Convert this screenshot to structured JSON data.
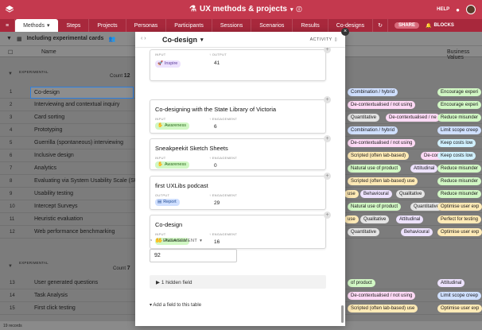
{
  "header": {
    "title": "UX methods & projects",
    "help": "HELP"
  },
  "tabs": [
    {
      "label": "Methods"
    },
    {
      "label": "Steps"
    },
    {
      "label": "Projects"
    },
    {
      "label": "Personas"
    },
    {
      "label": "Participants"
    },
    {
      "label": "Sessions"
    },
    {
      "label": "Scenarios"
    },
    {
      "label": "Results"
    },
    {
      "label": "Co-designs"
    }
  ],
  "share_label": "SHARE",
  "blocks_label": "BLOCKS",
  "view": {
    "name": "Including experimental cards"
  },
  "grid": {
    "name_header": "Name",
    "right_header": "Business Values",
    "section1": {
      "label": "EXPERIMENTAL",
      "count_label": "Count",
      "count": "12"
    },
    "section2": {
      "label": "EXPERIMENTAL",
      "count_label": "Count",
      "count": "7"
    },
    "rows1": [
      {
        "num": "1",
        "name": "Co-design"
      },
      {
        "num": "2",
        "name": "Interviewing and contextual inquiry"
      },
      {
        "num": "3",
        "name": "Card sorting"
      },
      {
        "num": "4",
        "name": "Prototyping"
      },
      {
        "num": "5",
        "name": "Guerrilla (spontaneous) interviewing"
      },
      {
        "num": "6",
        "name": "Inclusive design"
      },
      {
        "num": "7",
        "name": "Analytics"
      },
      {
        "num": "8",
        "name": "Evaluating via System Usability Scale (SU..."
      },
      {
        "num": "9",
        "name": "Usability testing"
      },
      {
        "num": "10",
        "name": "Intercept Surveys"
      },
      {
        "num": "11",
        "name": "Heuristic evaluation"
      },
      {
        "num": "12",
        "name": "Web performance benchmarking"
      }
    ],
    "rows2": [
      {
        "num": "13",
        "name": "User generated questions"
      },
      {
        "num": "14",
        "name": "Task Analysis"
      },
      {
        "num": "15",
        "name": "First click testing"
      }
    ],
    "pills": [
      {
        "row": 0,
        "items": [
          {
            "t": "Combination / hybrid",
            "c": "#cfdfff"
          },
          {
            "t": "Encourage experi",
            "c": "#d1f7c4"
          }
        ]
      },
      {
        "row": 1,
        "items": [
          {
            "t": "De-contextualised / not using",
            "c": "#ffdaf6"
          },
          {
            "t": "Encourage experi",
            "c": "#d1f7c4"
          }
        ]
      },
      {
        "row": 2,
        "items": [
          {
            "t": "Quantitative",
            "c": "#e4e4e4"
          },
          {
            "t": "De-contextualised / ne",
            "c": "#ffdaf6"
          },
          {
            "t": "Reduce misunder",
            "c": "#d1f7c4"
          }
        ]
      },
      {
        "row": 3,
        "items": [
          {
            "t": "Combination / hybrid",
            "c": "#cfdfff"
          },
          {
            "t": "Limit scope creep",
            "c": "#cfdfff"
          }
        ]
      },
      {
        "row": 4,
        "items": [
          {
            "t": "De-contextualised / not using",
            "c": "#ffdaf6"
          },
          {
            "t": "Keep costs low",
            "c": "#d0f0fd"
          }
        ]
      },
      {
        "row": 5,
        "items": [
          {
            "t": "Scripted (often lab-based)",
            "c": "#ffeab6"
          },
          {
            "t": "De-contextualised",
            "c": "#ffdaf6"
          },
          {
            "t": "Keep costs low",
            "c": "#d0f0fd"
          }
        ]
      },
      {
        "row": 6,
        "items": [
          {
            "t": "Natural use of product",
            "c": "#d1f7c4"
          },
          {
            "t": "Attitudinal",
            "c": "#ede2fe"
          },
          {
            "t": "Reduce misunder",
            "c": "#d1f7c4"
          }
        ]
      },
      {
        "row": 7,
        "items": [
          {
            "t": "Scripted (often lab-based) use",
            "c": "#ffeab6"
          },
          {
            "t": "Reduce misunder",
            "c": "#d1f7c4"
          }
        ]
      },
      {
        "row": 8,
        "items": [
          {
            "t": "use",
            "c": "#ffeab6"
          },
          {
            "t": "Behavioural",
            "c": "#ede2fe"
          },
          {
            "t": "Qualitative",
            "c": "#e4e4e4"
          },
          {
            "t": "Reduce misunder",
            "c": "#d1f7c4"
          }
        ]
      },
      {
        "row": 9,
        "items": [
          {
            "t": "Natural use of product",
            "c": "#d1f7c4"
          },
          {
            "t": "Quantitative",
            "c": "#e4e4e4"
          },
          {
            "t": "Optimise user exp",
            "c": "#ffeab6"
          }
        ]
      },
      {
        "row": 10,
        "items": [
          {
            "t": "use",
            "c": "#ffeab6"
          },
          {
            "t": "Qualitative",
            "c": "#e4e4e4"
          },
          {
            "t": "Attitudinal",
            "c": "#ede2fe"
          },
          {
            "t": "Perfect for testing",
            "c": "#ffeab6"
          }
        ]
      },
      {
        "row": 11,
        "items": [
          {
            "t": "Quantitative",
            "c": "#e4e4e4"
          },
          {
            "t": "Behavioural",
            "c": "#ede2fe"
          },
          {
            "t": "Optimise user exp",
            "c": "#ffeab6"
          }
        ]
      },
      {
        "row": 12,
        "items": [
          {
            "t": "of product",
            "c": "#d1f7c4"
          },
          {
            "t": "Attitudinal",
            "c": "#ede2fe"
          }
        ]
      },
      {
        "row": 13,
        "items": [
          {
            "t": "De-contextualised / not using",
            "c": "#ffdaf6"
          },
          {
            "t": "Limit scope creep",
            "c": "#cfdfff"
          }
        ]
      },
      {
        "row": 14,
        "items": [
          {
            "t": "Scripted (often lab-based) use",
            "c": "#ffeab6"
          },
          {
            "t": "Optimise user exp",
            "c": "#ffeab6"
          }
        ]
      }
    ],
    "records": "19 records"
  },
  "modal": {
    "title": "Co-design",
    "activity": "ACTIVITY",
    "cards": [
      {
        "title": "",
        "input_label": "INPUT",
        "output_label": "↑ OUTPUT",
        "tag": "Inspire",
        "tag_kind": "inspire",
        "tag_icon": "rocket-icon",
        "value": "41"
      },
      {
        "title": "Co-designing with the State Library of Victoria",
        "input_label": "INPUT",
        "output_label": "↑ ENGAGEMENT",
        "tag": "Awareness",
        "tag_kind": "awareness",
        "tag_icon": "hand-icon",
        "value": "6"
      },
      {
        "title": "Sneakpeekit Sketch Sheets",
        "input_label": "INPUT",
        "output_label": "↑ ENGAGEMENT",
        "tag": "Awareness",
        "tag_kind": "awareness",
        "tag_icon": "hand-icon",
        "value": "0"
      },
      {
        "title": "first UXLibs podcast",
        "input_label": "OUTPUT",
        "output_label": "↑ ENGAGEMENT",
        "tag": "Report",
        "tag_kind": "report",
        "tag_icon": "report-icon",
        "value": "29"
      },
      {
        "title": "Co-design",
        "input_label": "INPUT",
        "output_label": "↑ ENGAGEMENT",
        "tag": "Awareness",
        "tag_kind": "awareness",
        "tag_icon": "hand-icon",
        "value": "16"
      }
    ],
    "engagement_label": "ENGAGEMENT",
    "engagement_value": "92",
    "hidden_field": "1 hidden field",
    "add_field": "Add a field to this table"
  },
  "colors": {
    "brand": "#c4394e",
    "brand_dark": "#a8283c"
  }
}
